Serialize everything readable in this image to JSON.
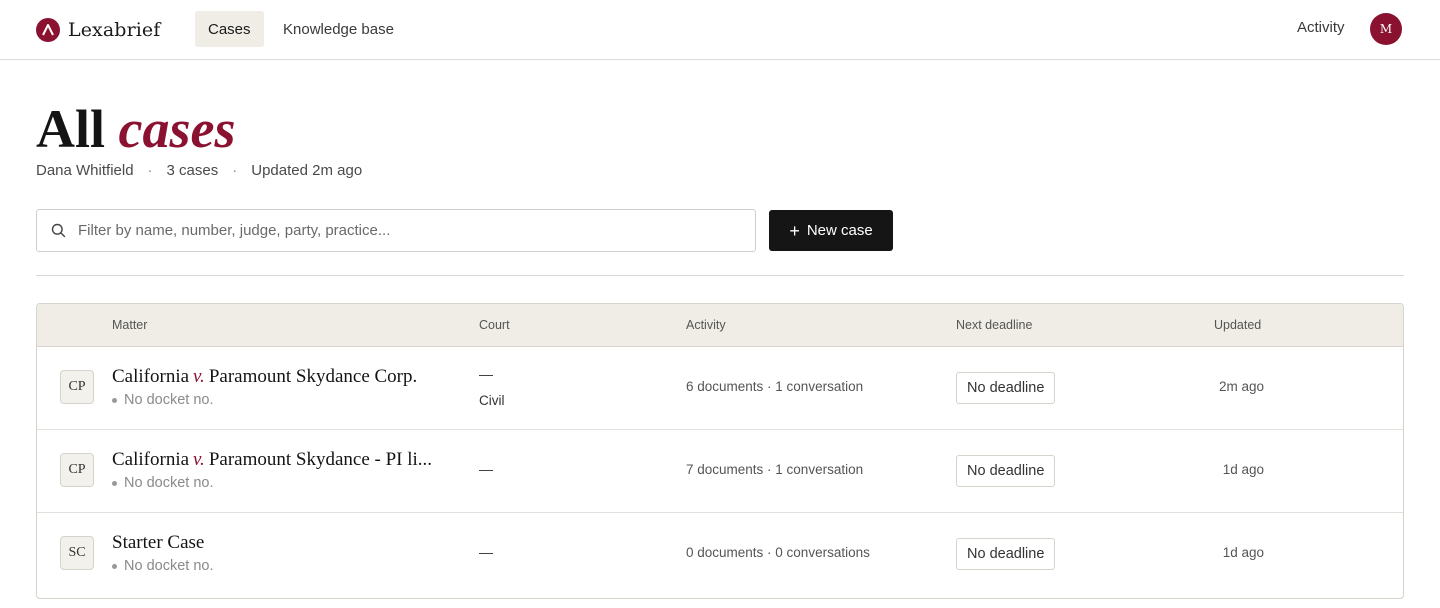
{
  "app": {
    "brand_name": "Lexabrief",
    "brand_color": "#8a1230"
  },
  "nav": {
    "tabs": [
      {
        "label": "Cases",
        "active": true
      },
      {
        "label": "Knowledge base",
        "active": false
      }
    ],
    "activity_label": "Activity",
    "avatar_initial": "M"
  },
  "header": {
    "title_plain": "All",
    "title_accent": "cases",
    "owner": "Dana Whitfield",
    "case_count": "3 cases",
    "updated": "Updated 2m ago",
    "separator": "·"
  },
  "toolbar": {
    "search_placeholder": "Filter by name, number, judge, party, practice...",
    "search_value": "",
    "new_case_label": "New case",
    "new_case_icon": "plus-icon"
  },
  "table": {
    "columns": [
      "Matter",
      "Court",
      "Activity",
      "Next deadline",
      "Updated"
    ],
    "rows": [
      {
        "initials": "CP",
        "party_a": "California",
        "versus": "v.",
        "party_b": "Paramount Skydance Corp.",
        "docket": "No docket no.",
        "court": "—",
        "court_type": "Civil",
        "activity": "6 documents · 1 conversation",
        "deadline": "No deadline",
        "updated": "2m ago"
      },
      {
        "initials": "CP",
        "party_a": "California",
        "versus": "v.",
        "party_b": "Paramount Skydance - PI li...",
        "docket": "No docket no.",
        "court": "—",
        "court_type": "",
        "activity": "7 documents · 1 conversation",
        "deadline": "No deadline",
        "updated": "1d ago"
      },
      {
        "initials": "SC",
        "name": "Starter Case",
        "docket": "No docket no.",
        "court": "—",
        "court_type": "",
        "activity": "0 documents · 0 conversations",
        "deadline": "No deadline",
        "updated": "1d ago"
      }
    ]
  }
}
